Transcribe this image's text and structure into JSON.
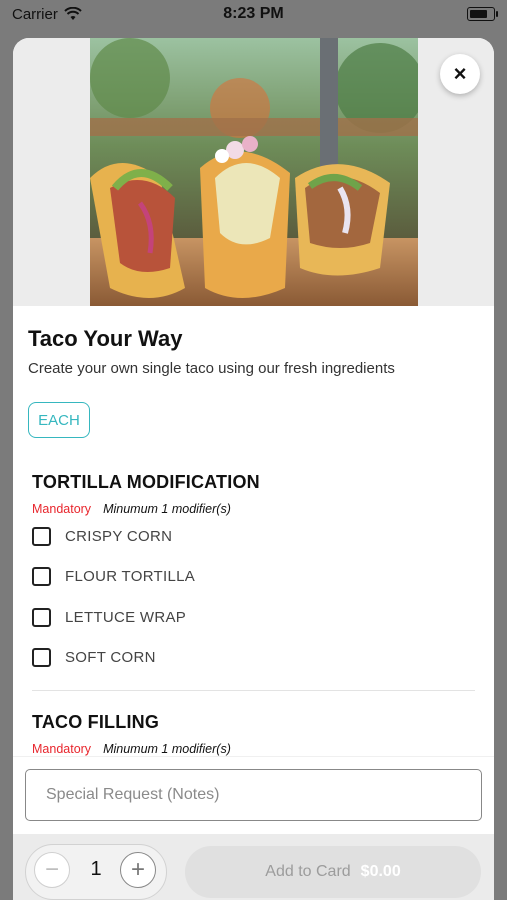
{
  "status": {
    "carrier": "Carrier",
    "time": "8:23 PM"
  },
  "item": {
    "title": "Taco Your Way",
    "description": "Create your own single taco using our fresh ingredients",
    "size_label": "EACH"
  },
  "sections": [
    {
      "title": "TORTILLA MODIFICATION",
      "mandatory": "Mandatory",
      "minimum": "Minumum 1 modifier(s)",
      "options": [
        "CRISPY CORN",
        "FLOUR TORTILLA",
        "LETTUCE WRAP",
        "SOFT CORN"
      ]
    },
    {
      "title": "TACO FILLING",
      "mandatory": "Mandatory",
      "minimum": "Minumum 1 modifier(s)"
    }
  ],
  "notes": {
    "placeholder": "Special Request (Notes)"
  },
  "quantity": {
    "value": "1",
    "minus": "−",
    "plus": "+"
  },
  "add_button": {
    "label": "Add to Card",
    "price": "$0.00"
  },
  "colors": {
    "accent": "#36b7bf",
    "mandatory": "#e8262d",
    "overlay": "#7b7b7b"
  }
}
